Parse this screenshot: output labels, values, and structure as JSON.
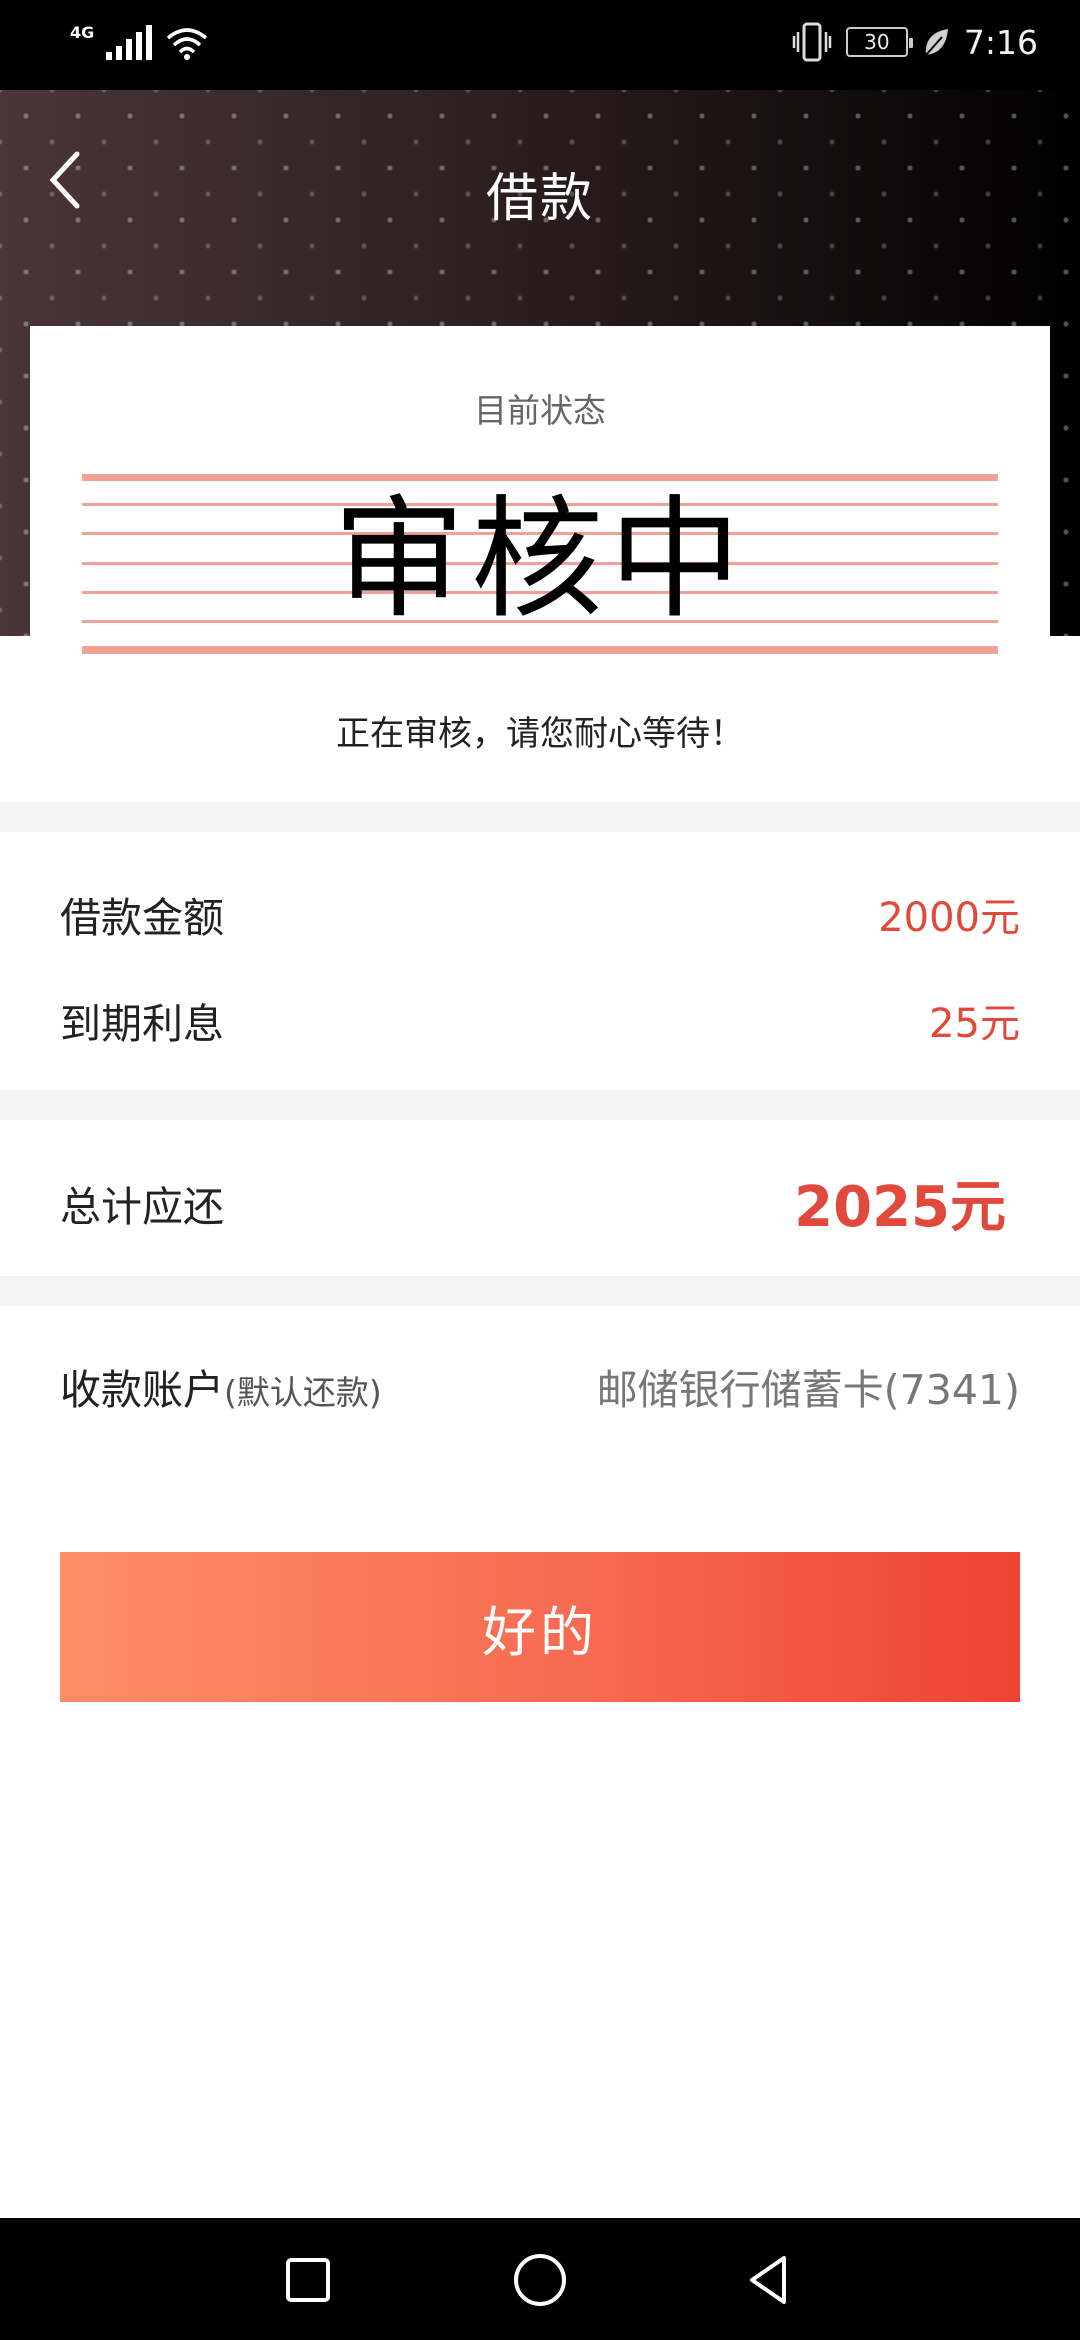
{
  "status_bar": {
    "network": "4G",
    "battery": "30",
    "time": "7:16"
  },
  "header": {
    "title": "借款",
    "back_icon": "chevron-left-icon"
  },
  "status_card": {
    "label": "目前状态",
    "status": "审核中",
    "message": "正在审核，请您耐心等待！",
    "line_color": "#f0a094"
  },
  "loan_details": {
    "amount_label": "借款金额",
    "amount_value": "2000元",
    "interest_label": "到期利息",
    "interest_value": "25元"
  },
  "total": {
    "label": "总计应还",
    "value": "2025元"
  },
  "account": {
    "label": "收款账户",
    "sub_label": "(默认还款)",
    "value": "邮储银行储蓄卡(7341)"
  },
  "confirm_button": {
    "label": "好的"
  },
  "colors": {
    "accent": "#e0493b",
    "button_start": "#fe8e67",
    "button_end": "#ee4234"
  },
  "nav_bar": {
    "icons": [
      "recent-apps-icon",
      "home-icon",
      "back-icon"
    ]
  }
}
